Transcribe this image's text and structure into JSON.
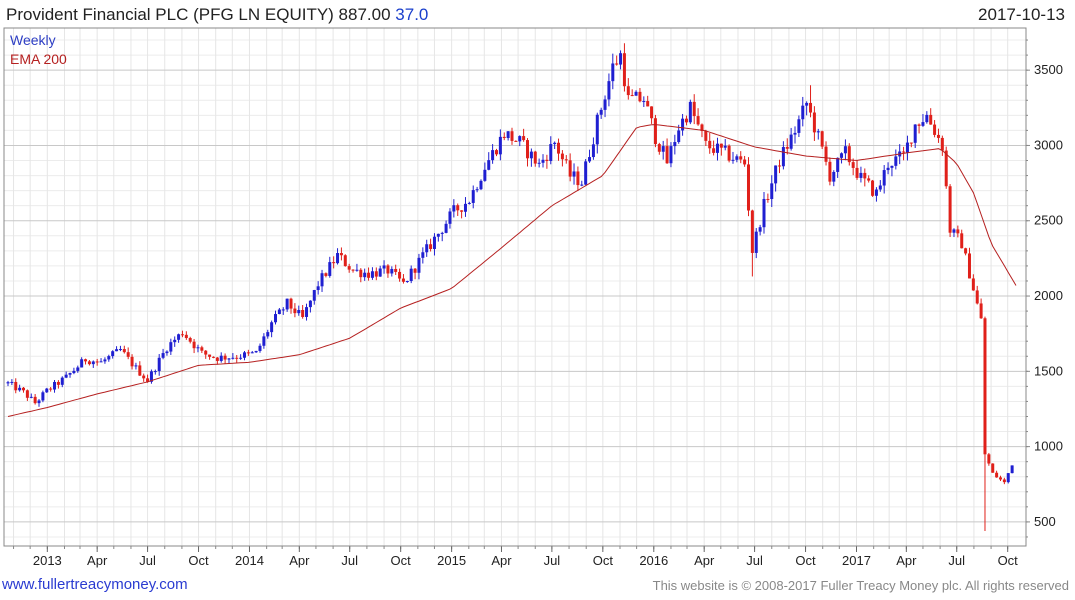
{
  "header": {
    "title": "Provident Financial PLC (PFG LN EQUITY) 887.00",
    "change": "37.0",
    "date": "2017-10-13"
  },
  "legend": {
    "series1": "Weekly",
    "series2": "EMA 200"
  },
  "footer": {
    "link": "www.fullertreacymoney.com",
    "copyright": "This website is © 2008-2017 Fuller Treacy Money plc. All rights reserved"
  },
  "colors": {
    "up": "#1f1fd1",
    "down": "#e0201a",
    "ema": "#b52020",
    "grid": "#dedede",
    "frame": "#888888"
  },
  "chart_data": {
    "type": "candlestick",
    "frequency": "weekly",
    "y_ticks": [
      500,
      1000,
      1500,
      2000,
      2500,
      3000,
      3500
    ],
    "ylim": [
      340,
      3780
    ],
    "x_range": [
      "2012-10-22",
      "2017-10-16"
    ],
    "x_ticks": [
      {
        "label": "2013",
        "date": "2013-01-01"
      },
      {
        "label": "Apr",
        "date": "2013-04-01"
      },
      {
        "label": "Jul",
        "date": "2013-07-01"
      },
      {
        "label": "Oct",
        "date": "2013-10-01"
      },
      {
        "label": "2014",
        "date": "2014-01-01"
      },
      {
        "label": "Apr",
        "date": "2014-04-01"
      },
      {
        "label": "Jul",
        "date": "2014-07-01"
      },
      {
        "label": "Oct",
        "date": "2014-10-01"
      },
      {
        "label": "2015",
        "date": "2015-01-01"
      },
      {
        "label": "Apr",
        "date": "2015-04-01"
      },
      {
        "label": "Jul",
        "date": "2015-07-01"
      },
      {
        "label": "Oct",
        "date": "2015-10-01"
      },
      {
        "label": "2016",
        "date": "2016-01-01"
      },
      {
        "label": "Apr",
        "date": "2016-04-01"
      },
      {
        "label": "Jul",
        "date": "2016-07-01"
      },
      {
        "label": "Oct",
        "date": "2016-10-01"
      },
      {
        "label": "2017",
        "date": "2017-01-01"
      },
      {
        "label": "Apr",
        "date": "2017-04-01"
      },
      {
        "label": "Jul",
        "date": "2017-07-01"
      },
      {
        "label": "Oct",
        "date": "2017-10-01"
      }
    ],
    "close_anchors": [
      [
        "2012-10-22",
        1420
      ],
      [
        "2012-11-19",
        1360
      ],
      [
        "2012-12-10",
        1290
      ],
      [
        "2012-12-31",
        1370
      ],
      [
        "2013-02-04",
        1460
      ],
      [
        "2013-03-11",
        1580
      ],
      [
        "2013-04-08",
        1560
      ],
      [
        "2013-05-13",
        1640
      ],
      [
        "2013-06-10",
        1520
      ],
      [
        "2013-07-01",
        1440
      ],
      [
        "2013-08-05",
        1660
      ],
      [
        "2013-09-02",
        1760
      ],
      [
        "2013-10-07",
        1620
      ],
      [
        "2013-11-04",
        1590
      ],
      [
        "2013-12-09",
        1600
      ],
      [
        "2014-01-13",
        1620
      ],
      [
        "2014-02-10",
        1820
      ],
      [
        "2014-03-10",
        1950
      ],
      [
        "2014-04-07",
        1850
      ],
      [
        "2014-05-05",
        2080
      ],
      [
        "2014-06-09",
        2270
      ],
      [
        "2014-07-07",
        2170
      ],
      [
        "2014-08-04",
        2150
      ],
      [
        "2014-09-08",
        2170
      ],
      [
        "2014-10-06",
        2080
      ],
      [
        "2014-11-03",
        2230
      ],
      [
        "2014-12-01",
        2380
      ],
      [
        "2015-01-05",
        2560
      ],
      [
        "2015-02-02",
        2640
      ],
      [
        "2015-03-02",
        2860
      ],
      [
        "2015-04-06",
        3080
      ],
      [
        "2015-05-04",
        3020
      ],
      [
        "2015-06-08",
        2870
      ],
      [
        "2015-07-06",
        3020
      ],
      [
        "2015-08-03",
        2800
      ],
      [
        "2015-08-24",
        2760
      ],
      [
        "2015-09-21",
        3160
      ],
      [
        "2015-10-19",
        3520
      ],
      [
        "2015-11-02",
        3600
      ],
      [
        "2015-11-16",
        3300
      ],
      [
        "2015-12-14",
        3310
      ],
      [
        "2016-01-04",
        3060
      ],
      [
        "2016-01-25",
        2890
      ],
      [
        "2016-02-15",
        3120
      ],
      [
        "2016-03-07",
        3250
      ],
      [
        "2016-04-04",
        3000
      ],
      [
        "2016-05-02",
        2960
      ],
      [
        "2016-06-13",
        2880
      ],
      [
        "2016-06-27",
        2300
      ],
      [
        "2016-07-18",
        2600
      ],
      [
        "2016-08-15",
        2900
      ],
      [
        "2016-09-12",
        3100
      ],
      [
        "2016-10-03",
        3280
      ],
      [
        "2016-10-24",
        3050
      ],
      [
        "2016-11-14",
        2800
      ],
      [
        "2016-12-12",
        2950
      ],
      [
        "2017-01-09",
        2780
      ],
      [
        "2017-02-06",
        2680
      ],
      [
        "2017-02-27",
        2880
      ],
      [
        "2017-03-27",
        2930
      ],
      [
        "2017-04-17",
        3140
      ],
      [
        "2017-05-08",
        3200
      ],
      [
        "2017-06-05",
        3000
      ],
      [
        "2017-06-19",
        2440
      ],
      [
        "2017-07-10",
        2350
      ],
      [
        "2017-07-31",
        2050
      ],
      [
        "2017-08-14",
        1840
      ],
      [
        "2017-08-21",
        950
      ],
      [
        "2017-09-04",
        820
      ],
      [
        "2017-09-25",
        760
      ],
      [
        "2017-10-09",
        887
      ]
    ],
    "ema_anchors": [
      [
        "2012-10-22",
        1200
      ],
      [
        "2013-01-01",
        1260
      ],
      [
        "2013-04-01",
        1350
      ],
      [
        "2013-07-01",
        1430
      ],
      [
        "2013-10-01",
        1540
      ],
      [
        "2014-01-01",
        1560
      ],
      [
        "2014-04-01",
        1610
      ],
      [
        "2014-07-01",
        1720
      ],
      [
        "2014-10-01",
        1920
      ],
      [
        "2015-01-01",
        2050
      ],
      [
        "2015-04-01",
        2320
      ],
      [
        "2015-07-01",
        2600
      ],
      [
        "2015-10-01",
        2800
      ],
      [
        "2015-12-01",
        3120
      ],
      [
        "2016-01-01",
        3140
      ],
      [
        "2016-04-01",
        3100
      ],
      [
        "2016-07-01",
        2990
      ],
      [
        "2016-10-01",
        2930
      ],
      [
        "2017-01-01",
        2900
      ],
      [
        "2017-04-01",
        2950
      ],
      [
        "2017-06-01",
        2980
      ],
      [
        "2017-07-01",
        2880
      ],
      [
        "2017-08-01",
        2680
      ],
      [
        "2017-09-01",
        2350
      ],
      [
        "2017-10-16",
        2070
      ]
    ],
    "extremes": [
      {
        "date": "2016-06-27",
        "low": 2130
      },
      {
        "date": "2016-10-10",
        "high": 3400
      },
      {
        "date": "2017-08-21",
        "low": 440
      }
    ]
  }
}
